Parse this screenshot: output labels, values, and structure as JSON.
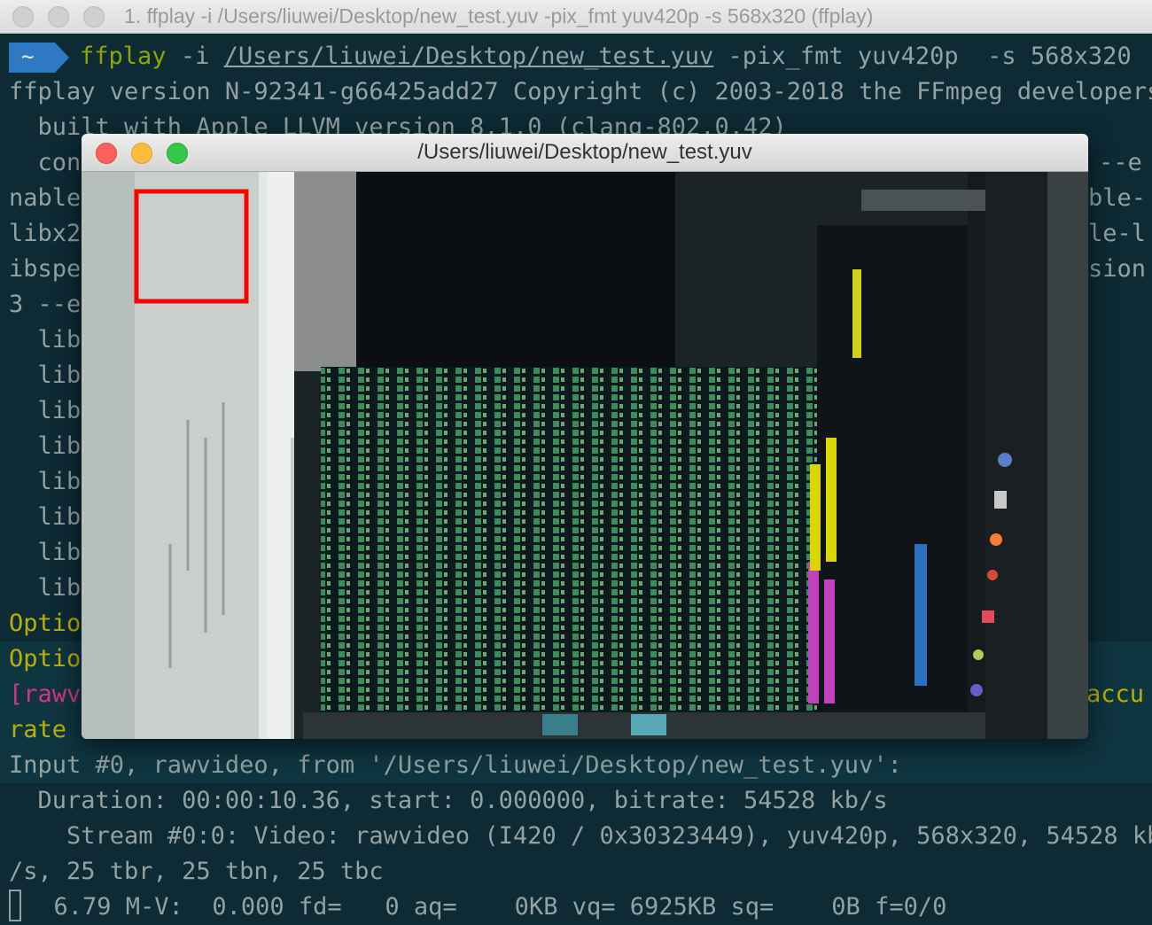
{
  "terminal": {
    "title": "1. ffplay -i /Users/liuwei/Desktop/new_test.yuv -pix_fmt yuv420p -s 568x320 (ffplay)",
    "prompt": "~",
    "command_program": "ffplay",
    "command_flag_i": "-i",
    "command_path": "/Users/liuwei/Desktop/new_test.yuv",
    "command_rest": "-pix_fmt yuv420p  -s 568x320",
    "lines": {
      "version": "ffplay version N-92341-g66425add27 Copyright (c) 2003-2018 the FFmpeg developers",
      "built": "  built with Apple LLVM version 8.1.0 (clang-802.0.42)",
      "l_config": "  con",
      "l_config_r": "--e",
      "l_nable": "nable",
      "l_nable_r": "ble-",
      "l_libx2": "libx2",
      "l_libx2_r": "le-l",
      "l_ibspe": "ibspe",
      "l_ibspe_r": "sion",
      "l_3e": "3 --e",
      "lib1": "  lib",
      "lib2": "  lib",
      "lib3": "  lib",
      "lib4": "  lib",
      "lib5": "  lib",
      "lib6": "  lib",
      "lib7": "  lib",
      "lib8": "  lib",
      "option1": "Optio",
      "option2": "Optio",
      "rawv": "[rawv",
      "rawv_r": "accu",
      "rate": "rate",
      "input": "Input #0, rawvideo, from '/Users/liuwei/Desktop/new_test.yuv':",
      "duration": "  Duration: 00:00:10.36, start: 0.000000, bitrate: 54528 kb/s",
      "stream": "    Stream #0:0: Video: rawvideo (I420 / 0x30323449), yuv420p, 568x320, 54528 kb",
      "stream2": "/s, 25 tbr, 25 tbn, 25 tbc",
      "status": "  6.79 M-V:  0.000 fd=   0 aq=    0KB vq= 6925KB sq=    0B f=0/0"
    }
  },
  "ffplay_window": {
    "title": "/Users/liuwei/Desktop/new_test.yuv"
  },
  "colors": {
    "terminal_bg": "#0d2a35",
    "terminal_text": "#93a1a1",
    "accent_yellow": "#b7b200",
    "accent_magenta": "#d33682",
    "prompt_blue": "#2f79c3",
    "highlight_box": "#ff0000",
    "traffic_red": "#fc615d",
    "traffic_yellow": "#fdbc40",
    "traffic_green": "#34c84a"
  }
}
